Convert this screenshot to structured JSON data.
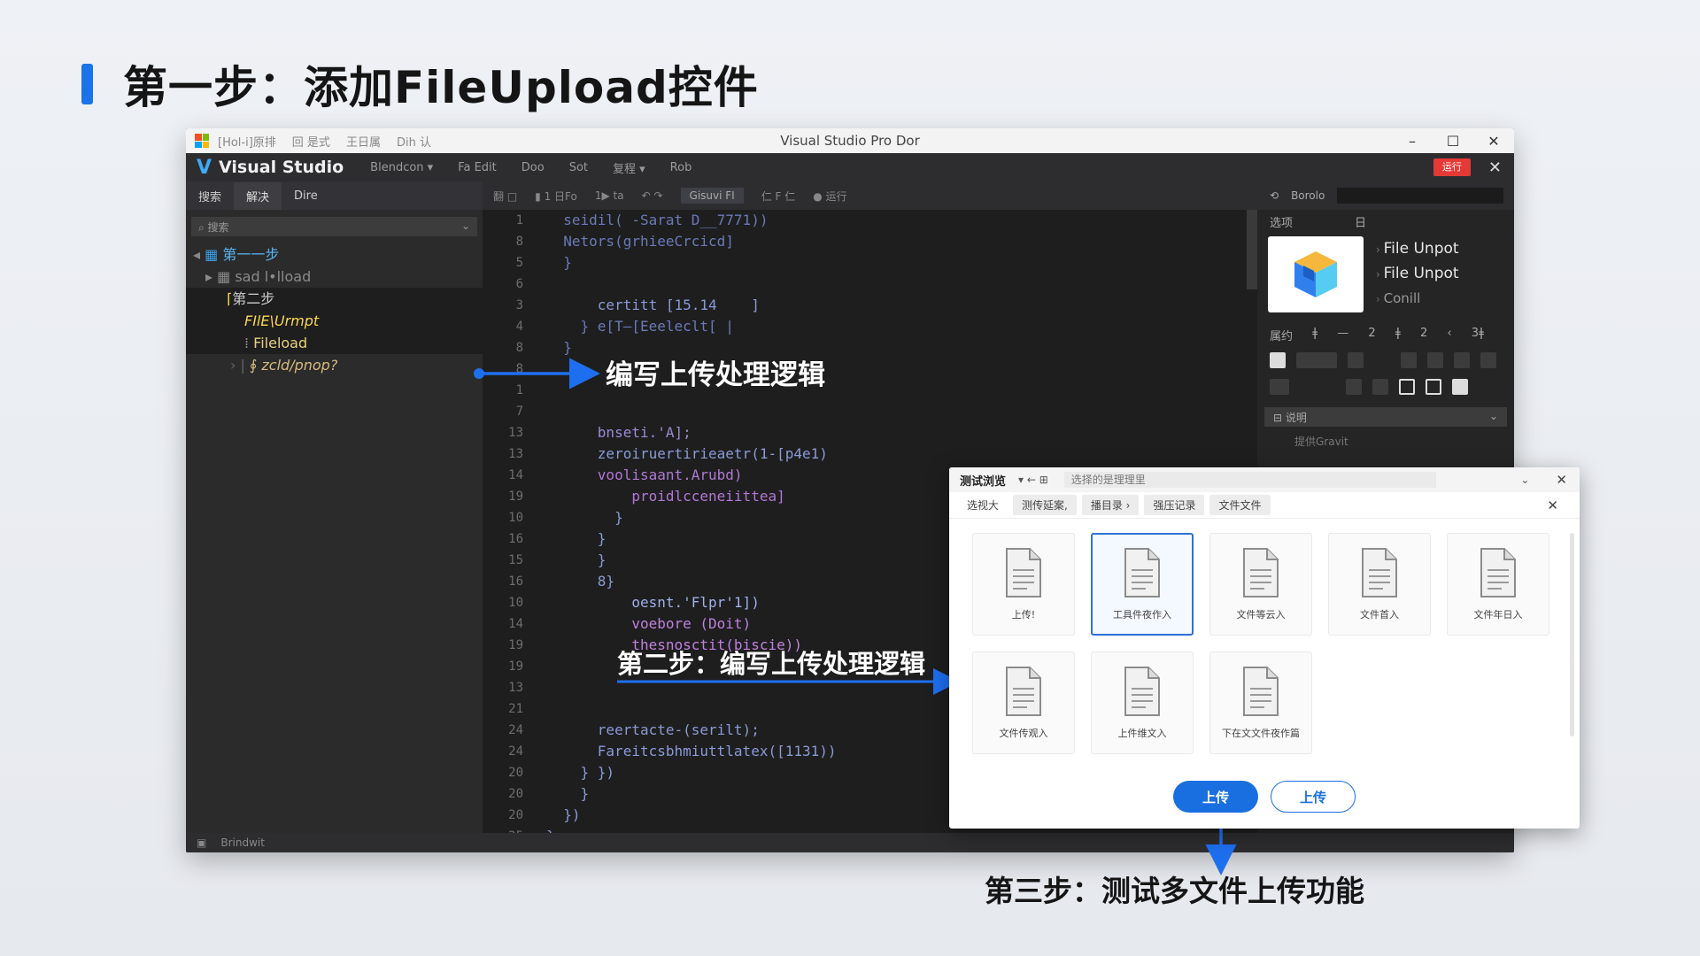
{
  "slide": {
    "title": "第一步：添加FileUpload控件"
  },
  "window": {
    "title": "Visual Studio Pro Dor",
    "title_items": [
      "[Hol-i]原排",
      "回 是式",
      "王日属",
      "Dih 认"
    ],
    "controls": [
      "–",
      "☐",
      "✕"
    ]
  },
  "menubar": {
    "brand": "Visual Studio",
    "items": [
      "Blendcon ▾",
      "Fa  Edit",
      "Doo",
      "Sot",
      "复程 ▾",
      "Rob"
    ],
    "red_button": "运行"
  },
  "left_panel": {
    "tabs": [
      "搜索",
      "解决",
      "Dire"
    ],
    "search_placeholder": "⌕ 搜索",
    "tree": [
      {
        "text": "第一一步",
        "color": "#5ab4f0"
      },
      {
        "text": "▸ ▦ sad l•lload",
        "color": "#8a8a8a"
      },
      {
        "text": "第二步",
        "color": "#cccccc"
      },
      {
        "text": "FIlE\\Urmpt",
        "color": "#ffd54f"
      },
      {
        "text": "Fileload",
        "color": "#e8d27a"
      },
      {
        "text": "∮ zcld/pnop?",
        "color": "#d7ba7d"
      }
    ]
  },
  "editor": {
    "toolbar": [
      "翻 □",
      "▮ 1 日Fo",
      "1▶ ta",
      "↶ ↷",
      "Gisuvi FI",
      "仁 F 仁",
      "● 运行"
    ],
    "line_numbers": [
      "1",
      "8",
      "5",
      "6",
      "3",
      "4",
      "8",
      "8",
      "1",
      "7",
      "13",
      "13",
      "14",
      "19",
      "10",
      "16",
      "15",
      "16",
      "10",
      "14",
      "19",
      "19",
      "13",
      "21",
      "24",
      "24",
      "20",
      "20",
      "20",
      "25"
    ],
    "lines": [
      {
        "t": "  seidil( -Sarat D__7771))",
        "c": "#6a7ab8"
      },
      {
        "t": "  Netors(grhieeCrcicd]",
        "c": "#6a7ab8"
      },
      {
        "t": "  }",
        "c": "#6a7ab8"
      },
      {
        "t": "",
        "c": "#888"
      },
      {
        "t": "      certitt [15.14    ]",
        "c": "#8a9ad6"
      },
      {
        "t": "    } e[T—[Eeeleclt[ |",
        "c": "#6a7ab8"
      },
      {
        "t": "  }",
        "c": "#6a7ab8"
      },
      {
        "t": "",
        "c": "#888"
      },
      {
        "t": "",
        "c": "#888"
      },
      {
        "t": "",
        "c": "#888"
      },
      {
        "t": "      bnseti.'A];",
        "c": "#9c8ad6"
      },
      {
        "t": "      zeroiruertirieaetr(1-[p4e1)",
        "c": "#8a9ad6"
      },
      {
        "t": "      voolisaant.Arubd)",
        "c": "#b178d6"
      },
      {
        "t": "          proidlcceneiittea]",
        "c": "#b178d6"
      },
      {
        "t": "        }",
        "c": "#8a9ad6"
      },
      {
        "t": "      }",
        "c": "#8a9ad6"
      },
      {
        "t": "      }",
        "c": "#8a9ad6"
      },
      {
        "t": "      8}",
        "c": "#8a9ad6"
      },
      {
        "t": "          oesnt.'Flpr'1])",
        "c": "#9fb0ee"
      },
      {
        "t": "          voebore (Doit)",
        "c": "#c080e0"
      },
      {
        "t": "          thesnosctit(biscie))",
        "c": "#c080e0"
      },
      {
        "t": "",
        "c": "#888"
      },
      {
        "t": "",
        "c": "#888"
      },
      {
        "t": "",
        "c": "#888"
      },
      {
        "t": "      reertacte-(serilt);",
        "c": "#8a9ad6"
      },
      {
        "t": "      Fareitcsbhmiuttlatex([1131))",
        "c": "#8a9ad6"
      },
      {
        "t": "    } })",
        "c": "#8a9ad6"
      },
      {
        "t": "    }",
        "c": "#8a9ad6"
      },
      {
        "t": "  })",
        "c": "#8a9ad6"
      },
      {
        "t": "}",
        "c": "#8a9ad6"
      }
    ]
  },
  "right_panel": {
    "head": [
      "⟲",
      "Borolo"
    ],
    "sub": [
      "选项",
      "日"
    ],
    "list": [
      "File Unpot",
      "File Unpot",
      "Conill"
    ],
    "props_label": "属约",
    "props_nums": [
      "ǂ",
      "—",
      "2",
      "ǂ",
      "2",
      "‹",
      "3ǂ"
    ],
    "section": "⊟  说明",
    "item": "提供Gravit"
  },
  "status": {
    "text": "Brindwit"
  },
  "annotations": {
    "a1": "编写上传处理逻辑",
    "a2": "第二步：编写上传处理逻辑",
    "a3": "第三步：测试多文件上传功能"
  },
  "dialog": {
    "title": "测试浏览",
    "nav": "▾  ←  ⊞",
    "path": "选择的是理理里",
    "close": "✕",
    "tabs": [
      "选视大",
      "测传延案,",
      "播目录 ›",
      "强压记录",
      "文件文件"
    ],
    "files": [
      {
        "label": "上传!",
        "selected": false
      },
      {
        "label": "工具件夜作入",
        "selected": true
      },
      {
        "label": "文件等云入",
        "selected": false
      },
      {
        "label": "文件首入",
        "selected": false
      },
      {
        "label": "文件年日入",
        "selected": false
      },
      {
        "label": "文件传观入",
        "selected": false
      },
      {
        "label": "上件维文入",
        "selected": false
      },
      {
        "label": "下在文文件夜作篇",
        "selected": false
      }
    ],
    "btn_primary": "上传",
    "btn_secondary": "上传"
  },
  "colors": {
    "accent": "#1a6fe0",
    "title_bar": "#1a73e8",
    "annotation_arrow": "#1e6ff0"
  },
  "icons": {
    "file": "document-icon",
    "box": "cube-icon",
    "vs_logo": "vs-logo-icon"
  }
}
